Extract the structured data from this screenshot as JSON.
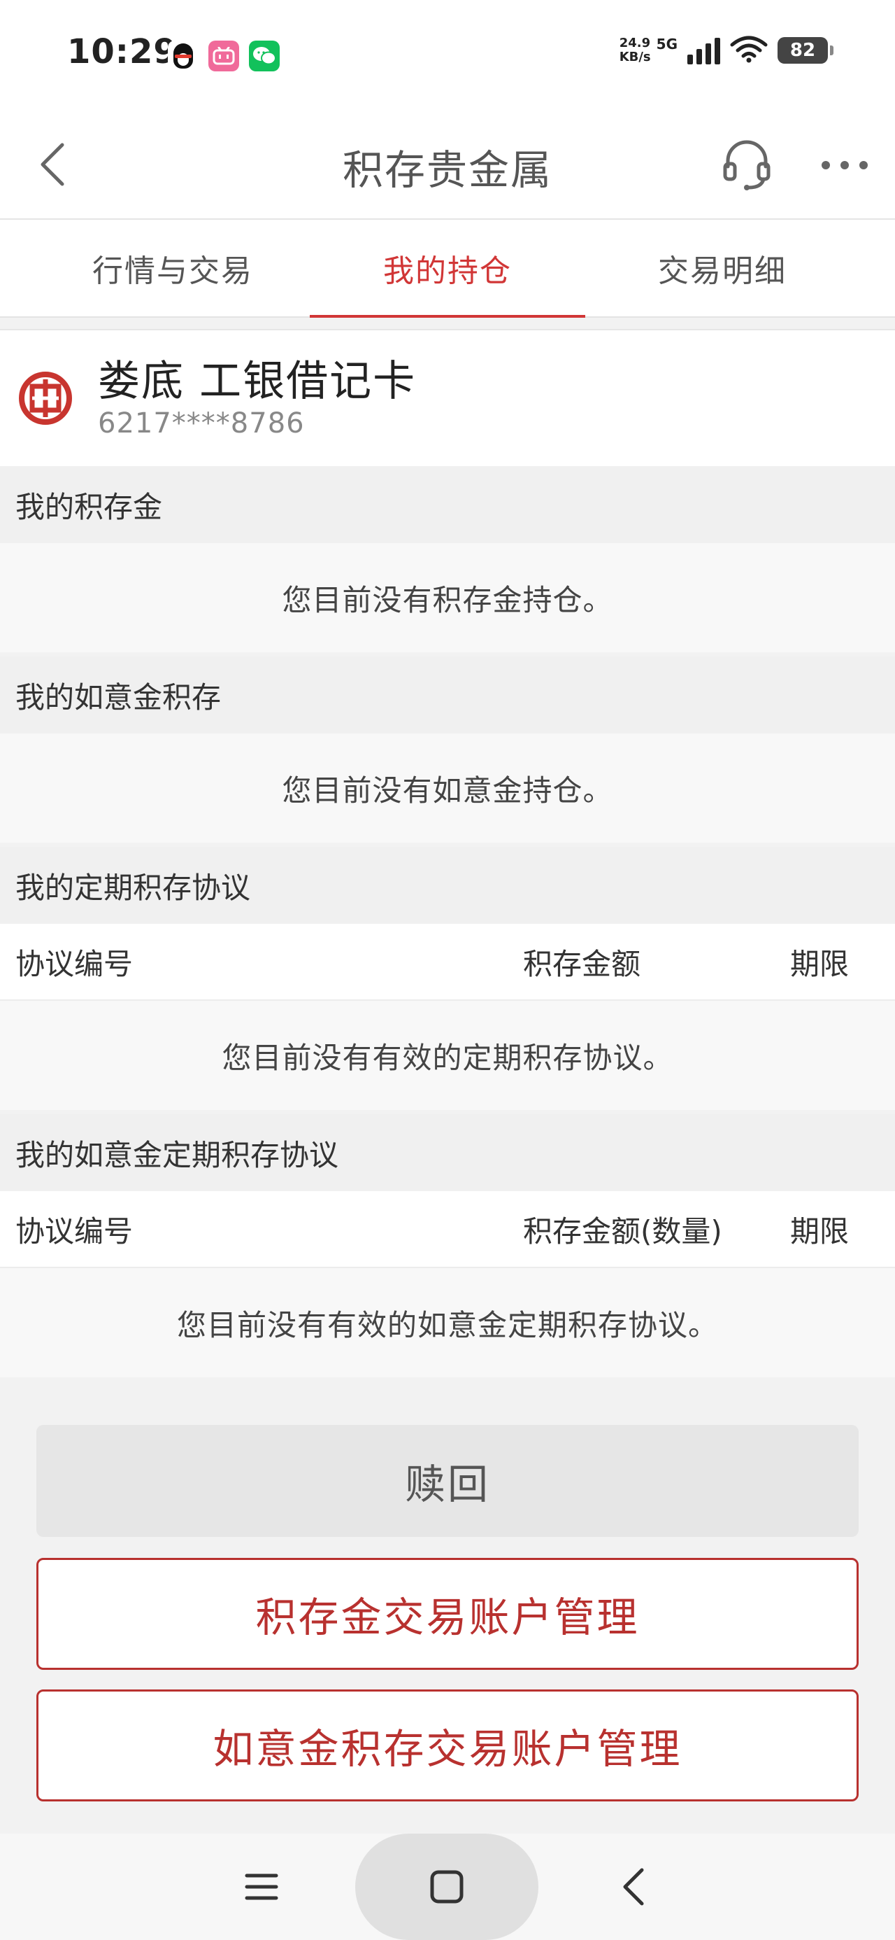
{
  "status_bar": {
    "time": "10:29",
    "net_speed_value": "24.9",
    "net_speed_unit": "KB/s",
    "network_gen": "5G",
    "battery": "82",
    "app_icons": [
      "qq-icon",
      "bilibili-icon",
      "wechat-icon"
    ]
  },
  "nav": {
    "title": "积存贵金属",
    "back_icon": "chevron-left-icon",
    "service_icon": "headset-icon",
    "more_icon": "more-horizontal-icon"
  },
  "tabs": [
    {
      "label": "行情与交易",
      "active": false
    },
    {
      "label": "我的持仓",
      "active": true
    },
    {
      "label": "交易明细",
      "active": false
    }
  ],
  "account": {
    "name": "娄底  工银借记卡",
    "number": "6217****8786"
  },
  "sections": {
    "gold": {
      "title": "我的积存金",
      "empty": "您目前没有积存金持仓。"
    },
    "ruyi": {
      "title": "我的如意金积存",
      "empty": "您目前没有如意金持仓。"
    },
    "fixed": {
      "title": "我的定期积存协议",
      "columns": [
        "协议编号",
        "积存金额",
        "期限"
      ],
      "empty": "您目前没有有效的定期积存协议。"
    },
    "ruyi_fixed": {
      "title": "我的如意金定期积存协议",
      "columns": [
        "协议编号",
        "积存金额(数量)",
        "期限"
      ],
      "empty": "您目前没有有效的如意金定期积存协议。"
    }
  },
  "buttons": {
    "redeem": "赎回",
    "gold_account": "积存金交易账户管理",
    "ruyi_account": "如意金积存交易账户管理"
  },
  "colors": {
    "accent": "#d13636",
    "button_border": "#b8312f"
  }
}
